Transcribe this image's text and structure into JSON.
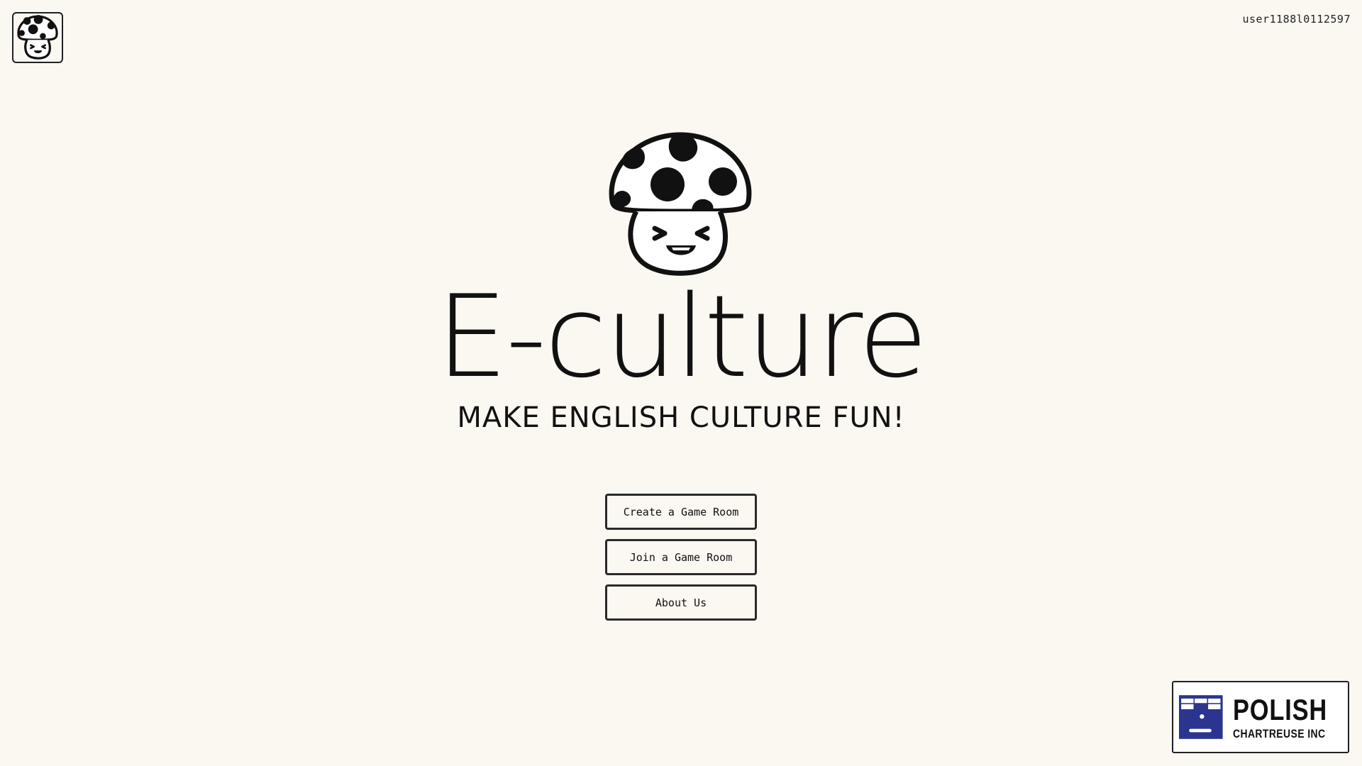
{
  "header": {
    "logo_icon": "mushroom-icon",
    "username": "user1188l0112597"
  },
  "hero": {
    "mascot_icon": "mushroom-icon",
    "title": "E-culture",
    "tagline": "MAKE ENGLISH CULTURE FUN!"
  },
  "menu": {
    "create_label": "Create a Game Room",
    "join_label": "Join a Game Room",
    "about_label": "About Us"
  },
  "sponsor": {
    "name": "POLISH",
    "subtitle": "CHARTREUSE INC",
    "brand_color": "#2b3590"
  },
  "colors": {
    "background": "#fbf7f1",
    "ink": "#111111"
  }
}
